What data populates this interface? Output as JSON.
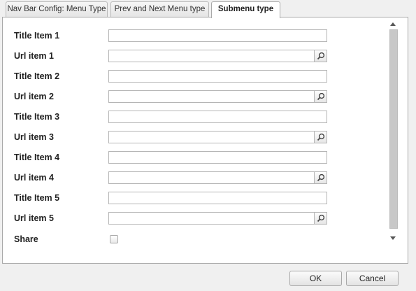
{
  "tabs": [
    {
      "label": "Nav Bar Config: Menu Type",
      "active": false
    },
    {
      "label": "Prev and Next Menu type",
      "active": false
    },
    {
      "label": "Submenu type",
      "active": true
    }
  ],
  "form": {
    "title_item_1": {
      "label": "Title Item 1",
      "value": ""
    },
    "url_item_1": {
      "label": "Url item 1",
      "value": ""
    },
    "title_item_2": {
      "label": "Title Item 2",
      "value": ""
    },
    "url_item_2": {
      "label": "Url item 2",
      "value": ""
    },
    "title_item_3": {
      "label": "Title Item 3",
      "value": ""
    },
    "url_item_3": {
      "label": "Url item 3",
      "value": ""
    },
    "title_item_4": {
      "label": "Title Item 4",
      "value": ""
    },
    "url_item_4": {
      "label": "Url item 4",
      "value": ""
    },
    "title_item_5": {
      "label": "Title Item 5",
      "value": ""
    },
    "url_item_5": {
      "label": "Url item 5",
      "value": ""
    },
    "share": {
      "label": "Share",
      "checked": false
    }
  },
  "icons": {
    "lookup": "magnifier-icon",
    "scroll_up": "triangle-up-icon",
    "scroll_down": "triangle-down-icon"
  },
  "footer": {
    "ok_label": "OK",
    "cancel_label": "Cancel"
  }
}
